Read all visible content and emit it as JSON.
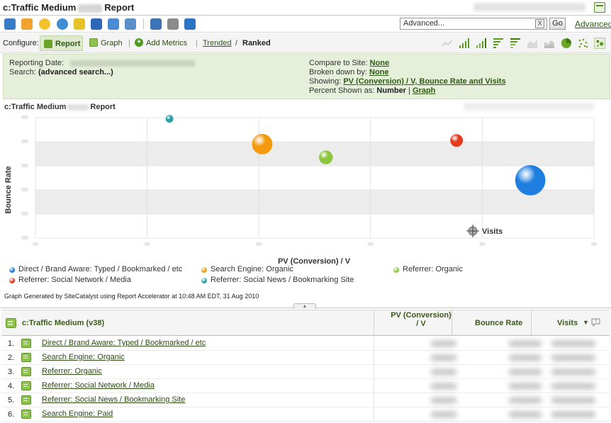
{
  "title": {
    "prefix": "c:Traffic Medium",
    "suffix": "Report"
  },
  "toolbar": {
    "icons": [
      "save-icon",
      "email-icon",
      "bookmark-icon",
      "dashboard-icon",
      "alert-icon",
      "data-extract-icon",
      "add-dashboard-icon",
      "export-icon",
      "excel-icon",
      "print-icon",
      "download-icon"
    ],
    "search_value": "Advanced...",
    "clear_label": "X",
    "go_label": "Go",
    "advanced_label": "Advanced"
  },
  "configure": {
    "label": "Configure:",
    "report_tab": "Report",
    "graph_tab": "Graph",
    "add_metrics": "Add Metrics",
    "trended": "Trended",
    "separator": "/",
    "ranked": "Ranked",
    "graph_types": [
      "trend-line-icon",
      "bar-chart-icon",
      "stacked-bar-icon",
      "horizontal-bar-icon",
      "stacked-horizontal-icon",
      "area-icon",
      "stacked-area-icon",
      "pie-icon",
      "scatter-icon",
      "bubble-icon"
    ]
  },
  "info": {
    "reporting_date_label": "Reporting Date:",
    "search_label": "Search:",
    "search_value": "(advanced search...)",
    "compare_label": "Compare to Site:",
    "compare_value": "None",
    "broken_label": "Broken down by:",
    "broken_value": "None",
    "showing_label": "Showing:",
    "showing_value": "PV (Conversion) / V, Bounce Rate and Visits",
    "percent_label": "Percent Shown as:",
    "percent_value": "Number",
    "percent_sep": "|",
    "percent_link": "Graph"
  },
  "chart_title": {
    "prefix": "c:Traffic Medium",
    "suffix": "Report"
  },
  "chart_data": {
    "type": "bubble",
    "xlabel": "PV (Conversion) / V",
    "ylabel": "Bounce Rate",
    "size_label": "Visits",
    "xlim": [
      0,
      5
    ],
    "ylim": [
      0,
      5
    ],
    "bands": [
      [
        1,
        2
      ],
      [
        3,
        4
      ]
    ],
    "series": [
      {
        "name": "Direct / Brand Aware: Typed / Bookmarked / etc",
        "color": "#1e7fe0",
        "x": 4.43,
        "y": 2.4,
        "size": 1.0
      },
      {
        "name": "Search Engine: Organic",
        "color": "#f49a0e",
        "x": 2.03,
        "y": 3.9,
        "size": 0.45
      },
      {
        "name": "Referrer: Organic",
        "color": "#8cc63e",
        "x": 2.6,
        "y": 3.35,
        "size": 0.2
      },
      {
        "name": "Referrer: Social Network / Media",
        "color": "#e23b1e",
        "x": 3.77,
        "y": 4.05,
        "size": 0.17
      },
      {
        "name": "Referrer: Social News / Bookmarking Site",
        "color": "#2aa0a8",
        "x": 1.2,
        "y": 4.95,
        "size": 0.06
      }
    ]
  },
  "legend": [
    {
      "label": "Direct / Brand Aware: Typed / Bookmarked / etc",
      "color": "#1e7fe0"
    },
    {
      "label": "Search Engine: Organic",
      "color": "#f49a0e"
    },
    {
      "label": "Referrer: Organic",
      "color": "#8cc63e"
    },
    {
      "label": "Referrer: Social Network / Media",
      "color": "#e23b1e"
    },
    {
      "label": "Referrer: Social News / Bookmarking Site",
      "color": "#2aa0a8"
    }
  ],
  "footer_note": "Graph Generated by SiteCatalyst using Report Accelerator at 10:48 AM EDT, 31 Aug 2010",
  "table": {
    "columns": {
      "dimension": "c:Traffic Medium (v38)",
      "pv": "PV (Conversion) / V",
      "bounce": "Bounce Rate",
      "visits": "Visits"
    },
    "sort_indicator": "▼",
    "rows": [
      {
        "num": "1.",
        "label": "Direct / Brand Aware: Typed / Bookmarked / etc"
      },
      {
        "num": "2.",
        "label": "Search Engine: Organic"
      },
      {
        "num": "3.",
        "label": "Referrer: Organic"
      },
      {
        "num": "4.",
        "label": "Referrer: Social Network / Media"
      },
      {
        "num": "5.",
        "label": "Referrer: Social News / Bookmarking Site"
      },
      {
        "num": "6.",
        "label": "Search Engine: Paid"
      }
    ]
  },
  "colors": {
    "accent": "#2b5a12",
    "panel": "#e6efd9",
    "band": "#ececec"
  }
}
